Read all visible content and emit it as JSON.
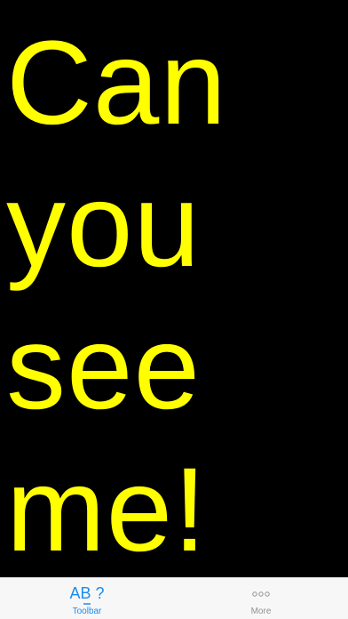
{
  "display": {
    "text": "Can\nyou\nsee\nme!",
    "text_color": "#ffff00",
    "background_color": "#000000"
  },
  "tabbar": {
    "tabs": [
      {
        "label": "Toolbar",
        "icon": "ab-question-icon",
        "icon_text": "AB ?",
        "active": true
      },
      {
        "label": "More",
        "icon": "more-dots-icon",
        "active": false
      }
    ],
    "active_color": "#1a8cf0",
    "inactive_color": "#929292"
  }
}
